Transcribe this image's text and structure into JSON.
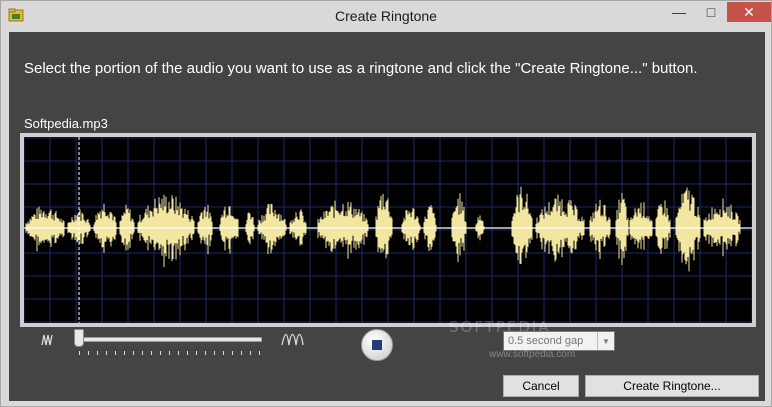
{
  "window": {
    "title": "Create Ringtone",
    "min_glyph": "—",
    "max_glyph": "□",
    "close_glyph": "✕",
    "app_icon": "folder-music-icon"
  },
  "main": {
    "instruction": "Select the portion of the audio you want to use as a ringtone and click the \"Create Ringtone...\" button.",
    "file_name": "Softpedia.mp3"
  },
  "waveform": {
    "background": "#000000",
    "grid_color": "#1a2a6a",
    "wave_color": "#f2e6a0",
    "baseline_color": "#ffffff",
    "marker_color": "#ffffff",
    "marker_position": 0.075
  },
  "controls": {
    "zoom_out_icon": "zoom-out-wave-icon",
    "zoom_in_icon": "zoom-in-wave-icon",
    "zoom_level": 0.0,
    "stop_icon": "stop-icon",
    "gap_select": {
      "value": "0.5 second gap"
    }
  },
  "buttons": {
    "cancel": "Cancel",
    "create": "Create Ringtone..."
  },
  "watermark": {
    "text": "SOFTPEDIA",
    "url": "www.softpedia.com"
  }
}
